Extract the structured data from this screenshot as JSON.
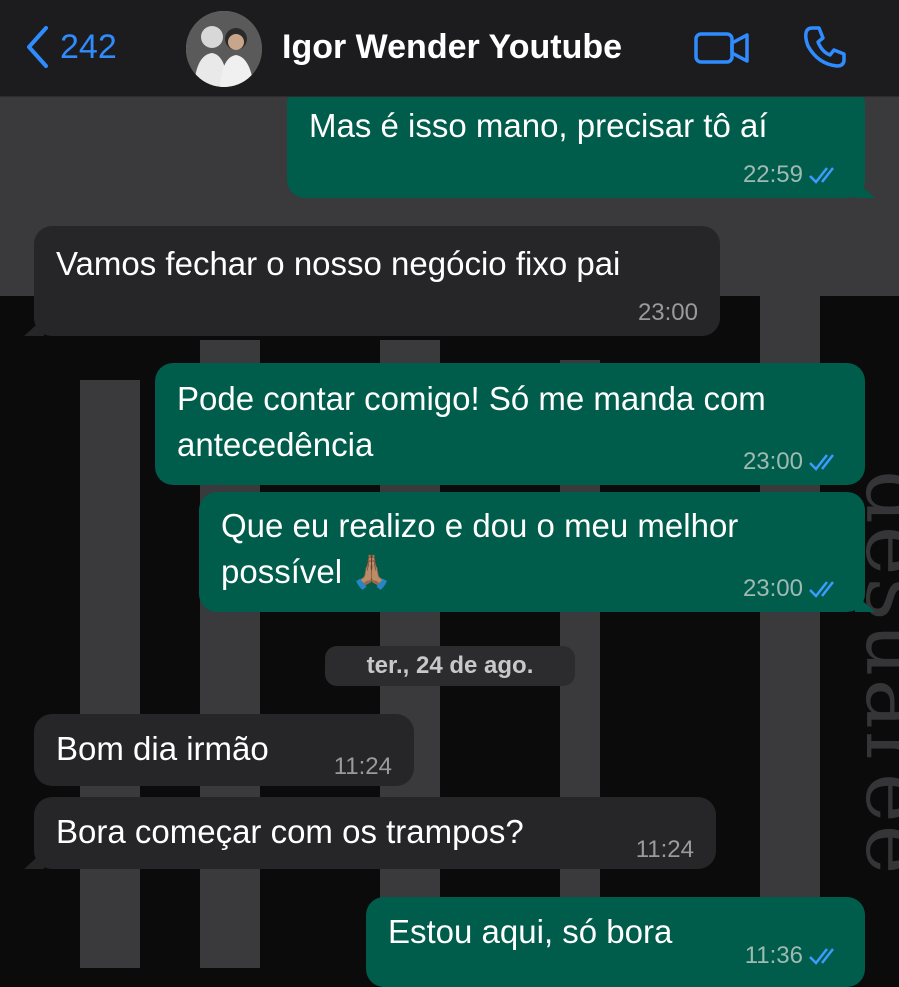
{
  "header": {
    "back_count": "242",
    "contact_name": "Igor Wender Youtube",
    "accent_color": "#2f8cff",
    "icons": [
      "chevron-left-icon",
      "video-camera-icon",
      "phone-icon"
    ]
  },
  "wallpaper_text": "desuaree",
  "messages": [
    {
      "direction": "out",
      "lines": [
        "Mas é isso mano, precisar tô aí"
      ],
      "time": "22:59",
      "read": true
    },
    {
      "direction": "in",
      "lines": [
        "Vamos fechar o nosso negócio fixo pai"
      ],
      "time": "23:00"
    },
    {
      "direction": "out",
      "lines": [
        "Pode contar comigo! Só me manda com",
        "antecedência"
      ],
      "time": "23:00",
      "read": true
    },
    {
      "direction": "out",
      "lines": [
        "Que eu realizo e dou o meu melhor",
        "possível 🙏🏽"
      ],
      "time": "23:00",
      "read": true
    },
    {
      "direction": "in",
      "lines": [
        "Bom dia irmão"
      ],
      "time": "11:24"
    },
    {
      "direction": "in",
      "lines": [
        "Bora começar com os trampos?"
      ],
      "time": "11:24"
    },
    {
      "direction": "out",
      "lines": [
        "Estou aqui, só bora"
      ],
      "time": "11:36",
      "read": true
    }
  ],
  "date_separator": "ter., 24 de ago.",
  "colors": {
    "outgoing_bubble": "#005c4b",
    "incoming_bubble": "#262628",
    "read_ticks": "#3b9cff"
  }
}
